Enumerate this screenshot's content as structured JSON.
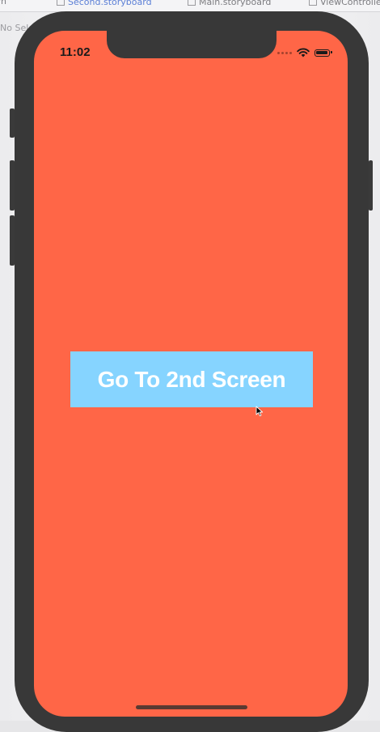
{
  "xcode": {
    "tabs": [
      {
        "label": "Second.storyboard"
      },
      {
        "label": "Main.storyboard"
      },
      {
        "label": "ViewController"
      }
    ],
    "selection_label": "No Selection"
  },
  "status_bar": {
    "time": "11:02"
  },
  "main_button": {
    "label": "Go To 2nd Screen"
  },
  "colors": {
    "screen_background": "#ff6647",
    "button_background": "#86d4ff",
    "button_text": "#ffffff"
  }
}
